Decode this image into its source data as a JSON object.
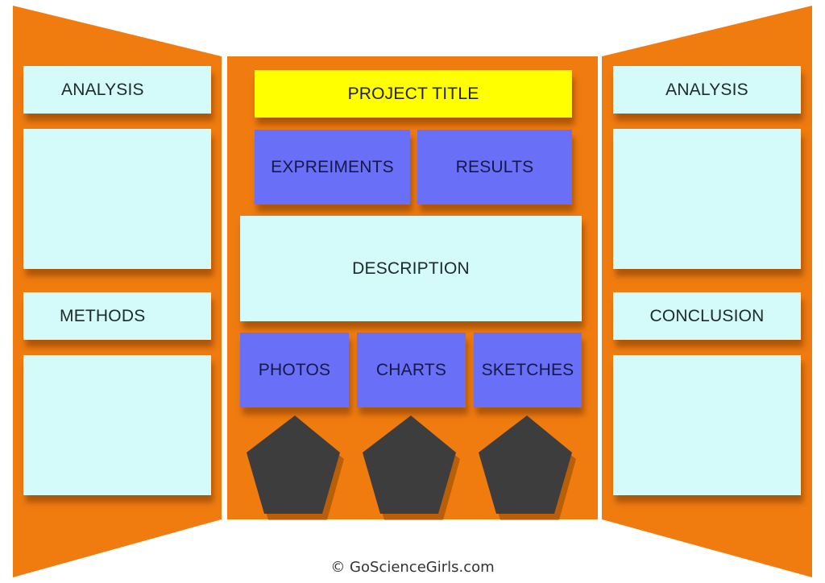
{
  "colors": {
    "board": "#f07c10",
    "panel_cyan": "#d4fbf9",
    "panel_blue": "#6a6ff7",
    "title_yellow": "#ffff00",
    "pentagon": "#3d3d3d"
  },
  "left_panel": {
    "heading_top": "ANALYSIS",
    "heading_bottom": "METHODS"
  },
  "center_panel": {
    "title": "PROJECT TITLE",
    "row1": [
      "EXPREIMENTS",
      "RESULTS"
    ],
    "description": "DESCRIPTION",
    "row2": [
      "PHOTOS",
      "CHARTS",
      "SKETCHES"
    ],
    "shapes": [
      "pentagon",
      "pentagon",
      "pentagon"
    ]
  },
  "right_panel": {
    "heading_top": "ANALYSIS",
    "heading_bottom": "CONCLUSION"
  },
  "footer": {
    "credit": "© GoScienceGirls.com"
  }
}
